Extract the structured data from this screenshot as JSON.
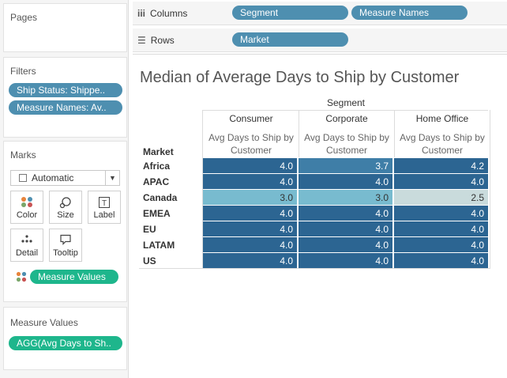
{
  "panels": {
    "pages": {
      "title": "Pages"
    },
    "filters": {
      "title": "Filters",
      "items": [
        "Ship Status: Shippe..",
        "Measure Names: Av.."
      ]
    },
    "marks": {
      "title": "Marks",
      "type_value": "Automatic",
      "buttons": [
        {
          "label": "Color",
          "icon": "color-dots-icon"
        },
        {
          "label": "Size",
          "icon": "size-icon"
        },
        {
          "label": "Label",
          "icon": "text-label-icon"
        },
        {
          "label": "Detail",
          "icon": "detail-dots-icon"
        },
        {
          "label": "Tooltip",
          "icon": "tooltip-icon"
        }
      ],
      "color_pill": "Measure Values"
    },
    "measure_values": {
      "title": "Measure Values",
      "pill": "AGG(Avg Days to Sh.."
    }
  },
  "shelves": {
    "columns": {
      "label": "Columns",
      "pills": [
        "Segment",
        "Measure Names"
      ]
    },
    "rows": {
      "label": "Rows",
      "pills": [
        "Market"
      ]
    }
  },
  "colors": {
    "pill_blue": "#4e8fb0",
    "pill_green": "#1eb68c",
    "cell_dark": "#2c6592",
    "cell_mid": "#78bbcf",
    "cell_light": "#c9dbdc"
  },
  "viz": {
    "title": "Median of Average Days to Ship by Customer",
    "column_group_header": "Segment",
    "row_header": "Market",
    "segments": [
      "Consumer",
      "Corporate",
      "Home Office"
    ],
    "measure_label": "Avg Days to Ship by Customer",
    "rows": [
      {
        "market": "Africa",
        "values": [
          "4.0",
          "3.7",
          "4.2"
        ]
      },
      {
        "market": "APAC",
        "values": [
          "4.0",
          "4.0",
          "4.0"
        ]
      },
      {
        "market": "Canada",
        "values": [
          "3.0",
          "3.0",
          "2.5"
        ]
      },
      {
        "market": "EMEA",
        "values": [
          "4.0",
          "4.0",
          "4.0"
        ]
      },
      {
        "market": "EU",
        "values": [
          "4.0",
          "4.0",
          "4.0"
        ]
      },
      {
        "market": "LATAM",
        "values": [
          "4.0",
          "4.0",
          "4.0"
        ]
      },
      {
        "market": "US",
        "values": [
          "4.0",
          "4.0",
          "4.0"
        ]
      }
    ]
  },
  "chart_data": {
    "type": "heatmap",
    "title": "Median of Average Days to Ship by Customer",
    "x": [
      "Consumer",
      "Corporate",
      "Home Office"
    ],
    "y": [
      "Africa",
      "APAC",
      "Canada",
      "EMEA",
      "EU",
      "LATAM",
      "US"
    ],
    "values": [
      [
        4.0,
        3.7,
        4.2
      ],
      [
        4.0,
        4.0,
        4.0
      ],
      [
        3.0,
        3.0,
        2.5
      ],
      [
        4.0,
        4.0,
        4.0
      ],
      [
        4.0,
        4.0,
        4.0
      ],
      [
        4.0,
        4.0,
        4.0
      ],
      [
        4.0,
        4.0,
        4.0
      ]
    ],
    "xlabel": "Segment",
    "ylabel": "Market"
  }
}
